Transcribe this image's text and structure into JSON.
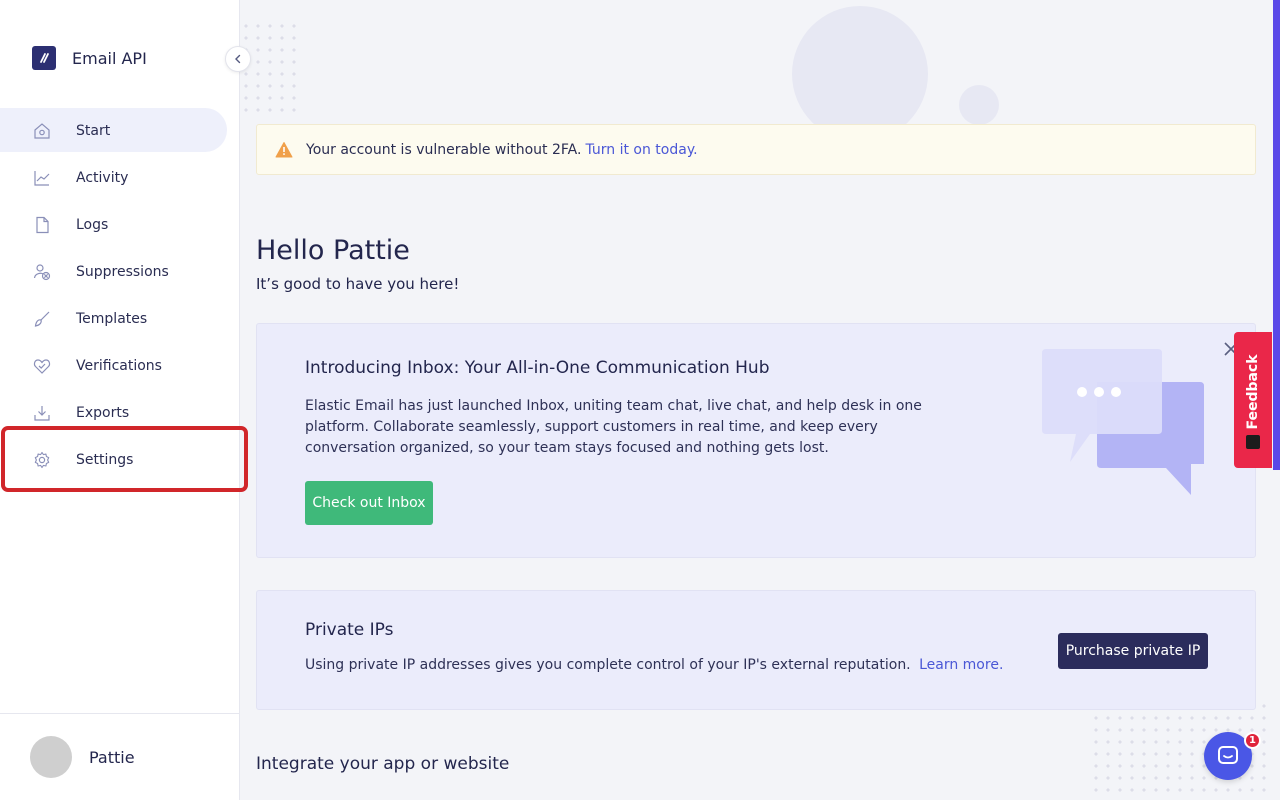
{
  "brand": {
    "name": "Email API"
  },
  "sidebar": {
    "items": [
      {
        "label": "Start",
        "icon": "home-icon",
        "active": true
      },
      {
        "label": "Activity",
        "icon": "chart-icon",
        "active": false
      },
      {
        "label": "Logs",
        "icon": "file-icon",
        "active": false
      },
      {
        "label": "Suppressions",
        "icon": "user-block-icon",
        "active": false
      },
      {
        "label": "Templates",
        "icon": "brush-icon",
        "active": false
      },
      {
        "label": "Verifications",
        "icon": "heart-check-icon",
        "active": false
      },
      {
        "label": "Exports",
        "icon": "download-icon",
        "active": false
      },
      {
        "label": "Settings",
        "icon": "gear-icon",
        "active": false
      }
    ]
  },
  "user": {
    "name": "Pattie"
  },
  "alert": {
    "text": "Your account is vulnerable without 2FA.",
    "link": "Turn it on today."
  },
  "greeting": {
    "title": "Hello Pattie",
    "subtitle": "It’s good to have you here!"
  },
  "inbox_card": {
    "title": "Introducing Inbox: Your All-in-One Communication Hub",
    "body": "Elastic Email has just launched Inbox, uniting team chat, live chat, and help desk in one platform. Collaborate seamlessly, support customers in real time, and keep every conversation organized, so your team stays focused and nothing gets lost.",
    "button": "Check out Inbox"
  },
  "ips_card": {
    "title": "Private IPs",
    "body": "Using private IP addresses gives you complete control of your IP's external reputation.",
    "link": "Learn more.",
    "button": "Purchase private IP"
  },
  "integrate": {
    "title": "Integrate your app or website"
  },
  "feedback": {
    "label": "Feedback"
  },
  "chat": {
    "badge": "1"
  },
  "colors": {
    "accent": "#4a57d6",
    "green": "#3fb97a",
    "dark_button": "#2b2c5c",
    "feedback": "#ea2749",
    "highlight": "#d1262a"
  }
}
